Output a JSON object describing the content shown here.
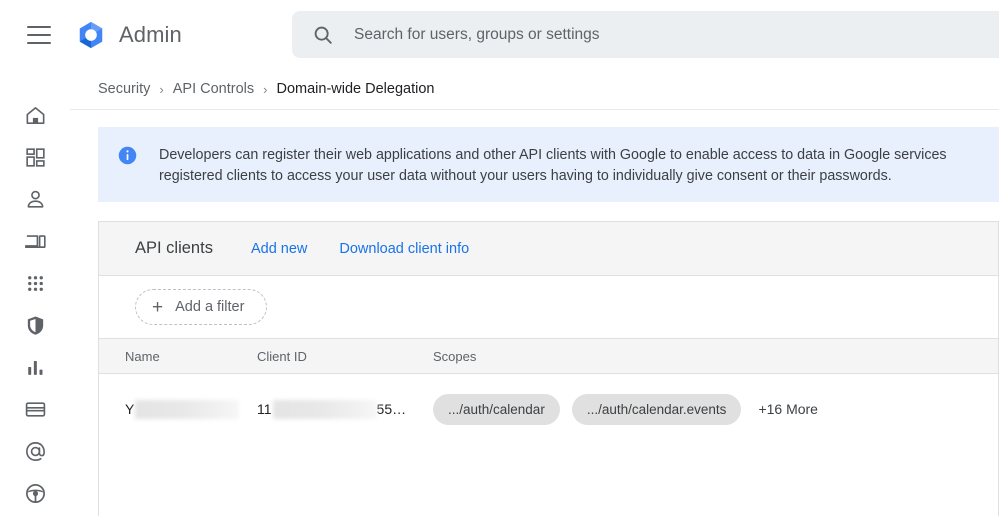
{
  "header": {
    "menu_icon": "hamburger-menu-icon",
    "logo_icon": "google-admin-hexagon-logo",
    "product_name": "Admin",
    "search": {
      "icon": "search-icon",
      "placeholder": "Search for users, groups or settings",
      "value": ""
    }
  },
  "sidebar": {
    "items": [
      {
        "icon": "home-icon",
        "name": "home"
      },
      {
        "icon": "dashboard-icon",
        "name": "dashboard"
      },
      {
        "icon": "person-icon",
        "name": "directory"
      },
      {
        "icon": "devices-icon",
        "name": "devices"
      },
      {
        "icon": "apps-grid-icon",
        "name": "apps"
      },
      {
        "icon": "shield-icon",
        "name": "security"
      },
      {
        "icon": "bar-chart-icon",
        "name": "reporting"
      },
      {
        "icon": "credit-card-icon",
        "name": "billing"
      },
      {
        "icon": "at-sign-icon",
        "name": "account"
      },
      {
        "icon": "steering-wheel-icon",
        "name": "admin-roles"
      }
    ]
  },
  "breadcrumb": {
    "items": [
      {
        "label": "Security",
        "current": false
      },
      {
        "label": "API Controls",
        "current": false
      },
      {
        "label": "Domain-wide Delegation",
        "current": true
      }
    ],
    "separator": "›"
  },
  "banner": {
    "icon": "info-icon",
    "line1": "Developers can register their web applications and other API clients with Google to enable access to data in Google services",
    "line2": "registered clients to access your user data without your users having to individually give consent or their passwords.",
    "accent_color": "#e8f0fe"
  },
  "card": {
    "title": "API clients",
    "actions": [
      {
        "label": "Add new"
      },
      {
        "label": "Download client info"
      }
    ],
    "filter": {
      "plus": "+",
      "label": "Add a filter"
    },
    "table": {
      "columns": [
        "Name",
        "Client ID",
        "Scopes"
      ],
      "rows": [
        {
          "name_prefix": "Y",
          "name_redacted": true,
          "client_prefix": "11",
          "client_suffix": "55…",
          "client_redacted": true,
          "scopes": [
            ".../auth/calendar",
            ".../auth/calendar.events"
          ],
          "more_label": "+16 More"
        }
      ]
    }
  }
}
